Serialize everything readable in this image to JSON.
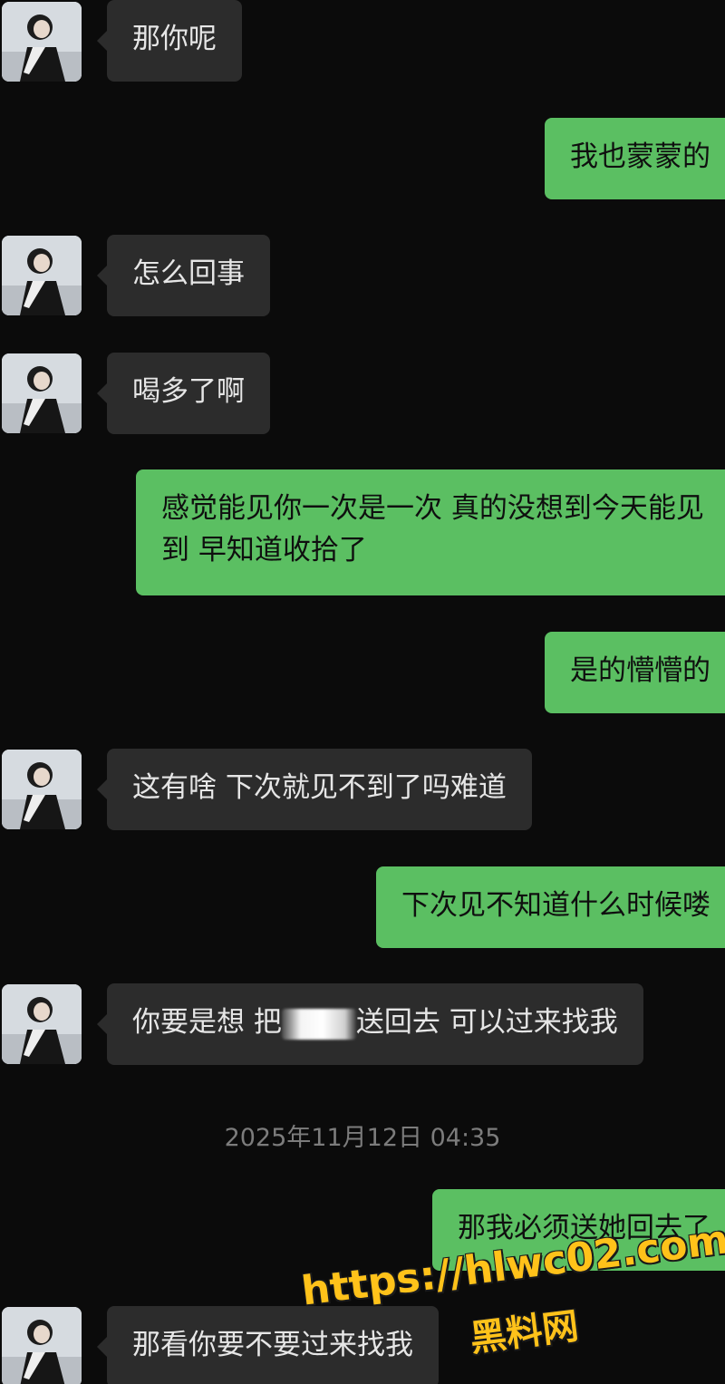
{
  "chat": {
    "messages": [
      {
        "side": "in",
        "text": "那你呢"
      },
      {
        "side": "out",
        "text": "我也蒙蒙的"
      },
      {
        "side": "in",
        "text": "怎么回事"
      },
      {
        "side": "in",
        "text": "喝多了啊"
      },
      {
        "side": "out",
        "text": "感觉能见你一次是一次 真的没想到今天能见到 早知道收拾了"
      },
      {
        "side": "out",
        "text": "是的懵懵的"
      },
      {
        "side": "in",
        "text": "这有啥 下次就见不到了吗难道"
      },
      {
        "side": "out",
        "text": "下次见不知道什么时候喽"
      },
      {
        "side": "in",
        "text_before": "你要是想 把",
        "text_after": "送回去 可以过来找我"
      },
      {
        "side": "out",
        "text": "那我必须送她回去了"
      },
      {
        "side": "in",
        "text": "那看你要不要过来找我"
      }
    ],
    "timestamp": "2025年11月12日 04:35"
  },
  "watermark": {
    "url": "https://hlwc02.com",
    "name": "黑料网",
    "color": "#ffc21a"
  },
  "colors": {
    "background": "#0b0b0b",
    "incoming_bubble": "#2c2c2c",
    "outgoing_bubble": "#5bbf62"
  }
}
